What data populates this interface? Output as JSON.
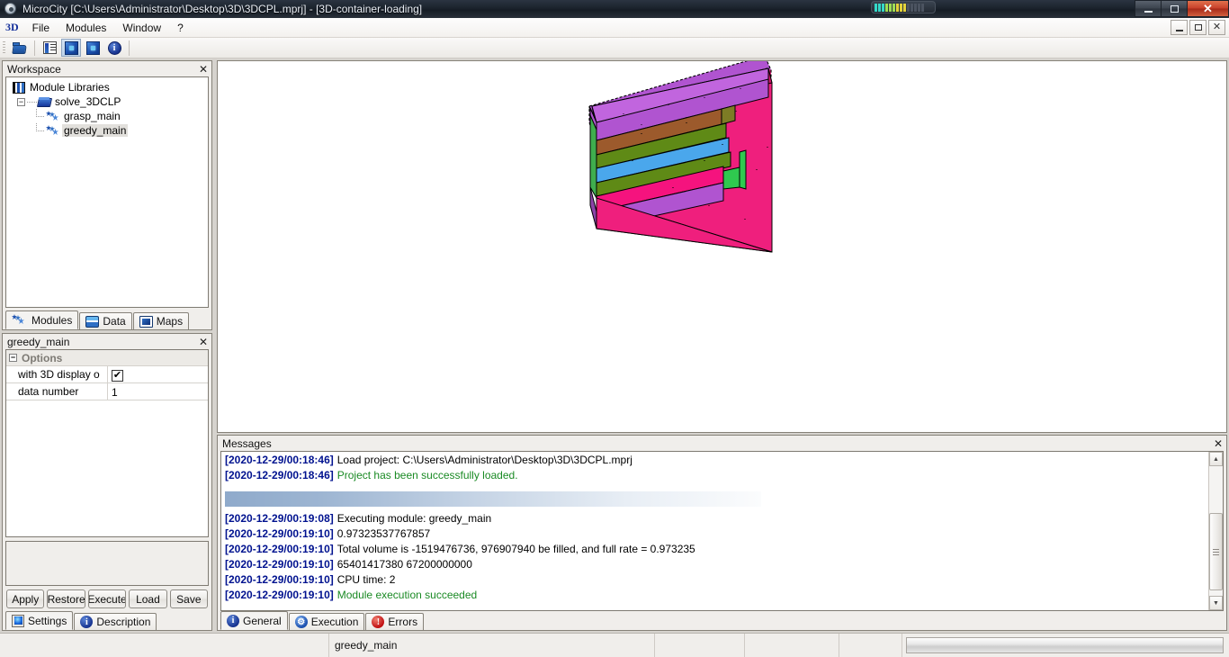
{
  "window": {
    "title": "MicroCity [C:\\Users\\Administrator\\Desktop\\3D\\3DCPL.mprj] - [3D-container-loading]",
    "minimize_label": "–",
    "maximize_label": "❐",
    "close_label": "✕",
    "mdi_minimize_label": "–",
    "mdi_restore_label": "❐",
    "mdi_close_label": "✕"
  },
  "menu": {
    "logo": "3D",
    "items": [
      "File",
      "Modules",
      "Window",
      "?"
    ]
  },
  "toolbar": {
    "buttons": [
      {
        "name": "open-project-button",
        "icon": "folder-open-icon",
        "pressed": false
      },
      {
        "name": "workspace-toggle-button",
        "icon": "form-list-icon",
        "pressed": false
      },
      {
        "name": "settings-view-button",
        "icon": "blue-square-icon",
        "pressed": true
      },
      {
        "name": "messages-view-button",
        "icon": "blue-square-icon",
        "pressed": false
      },
      {
        "name": "about-button",
        "icon": "info-icon",
        "pressed": false
      }
    ]
  },
  "workspace": {
    "caption": "Workspace",
    "close_label": "✕",
    "tree": [
      {
        "label": "Module Libraries",
        "icon": "library-icon",
        "level": 0,
        "selected": false
      },
      {
        "label": "solve_3DCLP",
        "icon": "book-icon",
        "level": 1,
        "selected": false,
        "expander": "−"
      },
      {
        "label": "grasp_main",
        "icon": "module-icon",
        "level": 2,
        "selected": false
      },
      {
        "label": "greedy_main",
        "icon": "module-icon",
        "level": 2,
        "selected": true
      }
    ],
    "tabs": [
      {
        "label": "Modules",
        "icon": "module-icon",
        "active": true
      },
      {
        "label": "Data",
        "icon": "data-icon",
        "active": false
      },
      {
        "label": "Maps",
        "icon": "maps-icon",
        "active": false
      }
    ]
  },
  "properties": {
    "caption": "greedy_main",
    "close_label": "✕",
    "group": {
      "label": "Options",
      "expander": "−"
    },
    "rows": [
      {
        "name": "with 3D display o",
        "type": "checkbox",
        "value": "✔",
        "checked": true
      },
      {
        "name": "data number",
        "type": "text",
        "value": "1"
      }
    ],
    "buttons": [
      "Apply",
      "Restore",
      "Execute",
      "Load",
      "Save"
    ],
    "tabs": [
      {
        "label": "Settings",
        "icon": "settings-icon",
        "active": true
      },
      {
        "label": "Description",
        "icon": "info-icon",
        "active": false
      }
    ]
  },
  "view3d": {
    "name": "3D-container-loading",
    "colors": {
      "container_top": "#b054d0",
      "container_front": "#ef1f7d",
      "layer_brown": "#9c5a2c",
      "layer_olive": "#5f8a16",
      "layer_blue": "#4aa7ec",
      "layer_pink": "#f5137e",
      "layer_purple": "#b054d0",
      "layer_green": "#2fc94f",
      "edge": "#000000"
    }
  },
  "messages": {
    "caption": "Messages",
    "close_label": "✕",
    "lines": [
      {
        "timestamp": "[2020-12-29/00:18:46]",
        "text": "Load project: C:\\Users\\Administrator\\Desktop\\3D\\3DCPL.mprj",
        "status": "normal"
      },
      {
        "timestamp": "[2020-12-29/00:18:46]",
        "text": "Project has been successfully loaded.",
        "status": "ok"
      },
      {
        "timestamp": "[2020-12-29/00:19:08]",
        "text": "Executing module: greedy_main",
        "status": "normal"
      },
      {
        "timestamp": "[2020-12-29/00:19:10]",
        "text": "0.97323537767857",
        "status": "normal"
      },
      {
        "timestamp": "[2020-12-29/00:19:10]",
        "text": "Total volume is -1519476736, 976907940 be filled, and full rate = 0.973235",
        "status": "normal"
      },
      {
        "timestamp": "[2020-12-29/00:19:10]",
        "text": "65401417380  67200000000",
        "status": "normal"
      },
      {
        "timestamp": "[2020-12-29/00:19:10]",
        "text": "CPU time: 2",
        "status": "normal"
      },
      {
        "timestamp": "[2020-12-29/00:19:10]",
        "text": "Module execution succeeded",
        "status": "ok"
      }
    ],
    "tabs": [
      {
        "label": "General",
        "icon": "info-icon",
        "active": true
      },
      {
        "label": "Execution",
        "icon": "execution-icon",
        "active": false
      },
      {
        "label": "Errors",
        "icon": "error-icon",
        "active": false
      }
    ],
    "scroll_up_label": "▲",
    "scroll_down_label": "▼"
  },
  "statusbar": {
    "pane1": "",
    "pane2": "greedy_main",
    "pane3": "",
    "pane4": "",
    "pane5": "",
    "pane6": ""
  },
  "colors": {
    "accent": "#00128f",
    "success": "#1a8a24",
    "face": "#f0eeeb",
    "mdi_back": "#d6d3ce"
  }
}
